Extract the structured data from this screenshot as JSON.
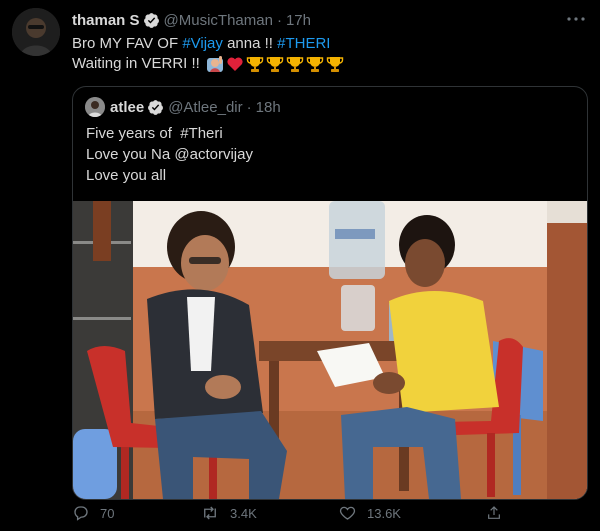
{
  "tweet": {
    "author_name": "thaman S",
    "author_handle": "@MusicThaman",
    "separator": "·",
    "time": "17h",
    "line1_prefix": "Bro MY FAV OF ",
    "hashtag_vijay": "#Vijay",
    "line1_mid": " anna !! ",
    "hashtag_theri": "#THERI",
    "line2_text": "Waiting in VERRI !! ",
    "emojis": [
      "raising-hand-emoji",
      "red-heart-emoji",
      "trophy-emoji",
      "trophy-emoji",
      "trophy-emoji",
      "trophy-emoji",
      "trophy-emoji"
    ]
  },
  "quote": {
    "author_name": "atlee",
    "author_handle": "@Atlee_dir",
    "separator": "·",
    "time": "18h",
    "lines": [
      "Five years of  #Theri",
      "Love you Na @actorvijay",
      "Love you all"
    ]
  },
  "actions": {
    "reply_count": "70",
    "retweet_count": "3.4K",
    "like_count": "13.6K"
  },
  "colors": {
    "background": "#000000",
    "text": "#d9d9d9",
    "muted": "#6e767d",
    "link": "#1d9bf0",
    "border": "#2f3336"
  }
}
